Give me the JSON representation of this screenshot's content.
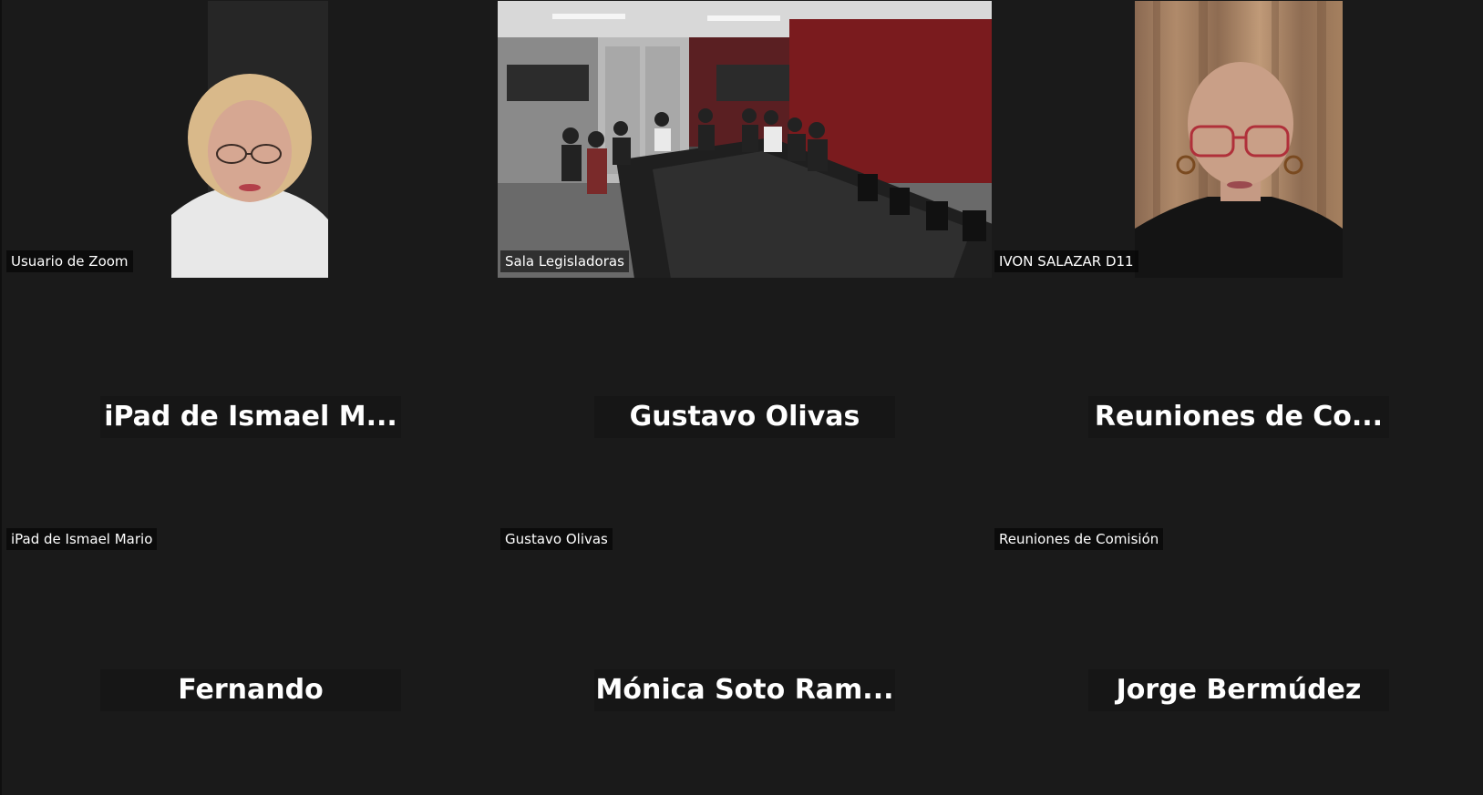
{
  "participants": {
    "t1": {
      "label": "Usuario de Zoom"
    },
    "t2": {
      "label": "Sala Legisladoras"
    },
    "t3": {
      "label": "IVON SALAZAR D11"
    },
    "t4": {
      "display": "iPad de Ismael M...",
      "label": "iPad de Ismael Mario"
    },
    "t5": {
      "display": "Gustavo Olivas",
      "label": "Gustavo Olivas"
    },
    "t6": {
      "display": "Reuniones de Co...",
      "label": "Reuniones de Comisión"
    },
    "t7": {
      "display": "Fernando"
    },
    "t8": {
      "display": "Mónica Soto Ram..."
    },
    "t9": {
      "display": "Jorge Bermúdez"
    }
  }
}
